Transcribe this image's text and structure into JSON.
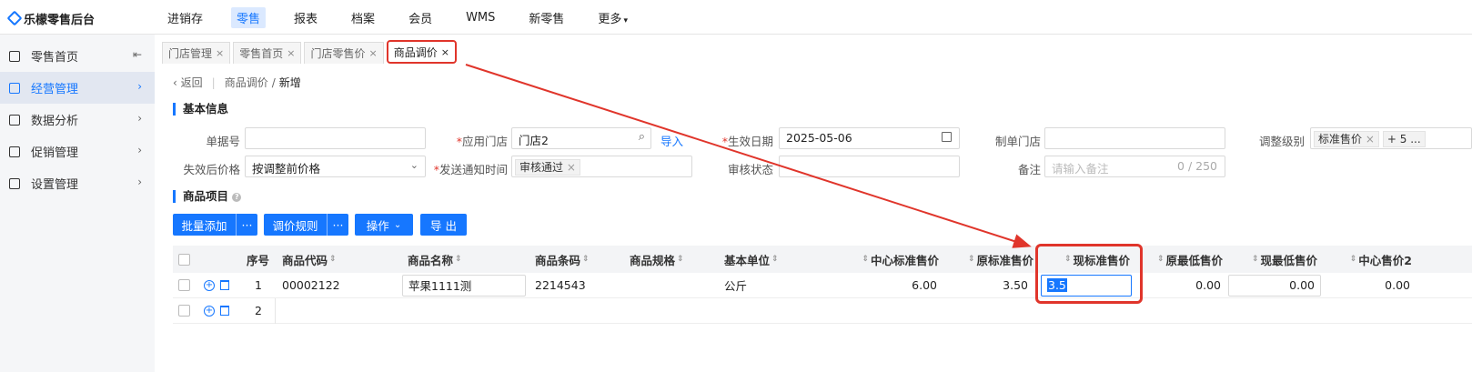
{
  "app": {
    "logo_text": "乐檬零售后台"
  },
  "topnav": {
    "items": [
      {
        "label": "进销存",
        "active": false
      },
      {
        "label": "零售",
        "active": true
      },
      {
        "label": "报表",
        "active": false
      },
      {
        "label": "档案",
        "active": false
      },
      {
        "label": "会员",
        "active": false
      },
      {
        "label": "WMS",
        "active": false
      },
      {
        "label": "新零售",
        "active": false
      },
      {
        "label": "更多",
        "active": false
      }
    ]
  },
  "sidebar": {
    "items": [
      {
        "label": "零售首页",
        "icon": "home-icon"
      },
      {
        "label": "经营管理",
        "icon": "chart-icon",
        "active": true
      },
      {
        "label": "数据分析",
        "icon": "analytics-icon"
      },
      {
        "label": "促销管理",
        "icon": "promotion-icon"
      },
      {
        "label": "设置管理",
        "icon": "folder-icon"
      }
    ]
  },
  "tabs": [
    {
      "label": "门店管理"
    },
    {
      "label": "零售首页"
    },
    {
      "label": "门店零售价"
    },
    {
      "label": "商品调价",
      "active": true
    }
  ],
  "breadcrumb": {
    "back": "返回",
    "parent": "商品调价",
    "slash": "/",
    "current": "新增"
  },
  "basic": {
    "title": "基本信息",
    "doc_no_label": "单据号",
    "doc_no_value": "",
    "store_label": "应用门店",
    "store_value": "门店2",
    "import_label": "导入",
    "effective_label": "生效日期",
    "effective_value": "2025-05-06",
    "make_store_label": "制单门店",
    "make_store_value": "",
    "level_label": "调整级别",
    "level_chip": "标准售价",
    "level_more": "+ 5 ...",
    "after_label": "失效后价格",
    "after_value": "按调整前价格",
    "notify_label": "发送通知时间",
    "notify_chip": "审核通过",
    "audit_label": "审核状态",
    "audit_value": "",
    "remark_label": "备注",
    "remark_placeholder": "请输入备注",
    "remark_count": "0 / 250"
  },
  "items_section": {
    "title": "商品项目"
  },
  "toolbar": {
    "batch_add": "批量添加",
    "more": "···",
    "rule": "调价规则",
    "op": "操作",
    "export": "导 出"
  },
  "table": {
    "headers": {
      "seq": "序号",
      "code": "商品代码",
      "name": "商品名称",
      "barcode": "商品条码",
      "spec": "商品规格",
      "unit": "基本单位",
      "center_std": "中心标准售价",
      "orig_std": "原标准售价",
      "cur_std": "现标准售价",
      "orig_min": "原最低售价",
      "cur_min": "现最低售价",
      "center2": "中心售价2"
    },
    "rows": [
      {
        "seq": "1",
        "code": "00002122",
        "name": "苹果1111测",
        "barcode": "2214543",
        "spec": "",
        "unit": "公斤",
        "center_std": "6.00",
        "orig_std": "3.50",
        "cur_std": "3.5",
        "orig_min": "0.00",
        "cur_min": "0.00",
        "center2": "0.00"
      },
      {
        "seq": "2",
        "code": "",
        "name": "",
        "barcode": "",
        "spec": "",
        "unit": "",
        "center_std": "",
        "orig_std": "",
        "cur_std": "",
        "orig_min": "",
        "cur_min": "",
        "center2": ""
      }
    ]
  },
  "colors": {
    "accent": "#1677ff",
    "annotation": "#e0352b"
  }
}
